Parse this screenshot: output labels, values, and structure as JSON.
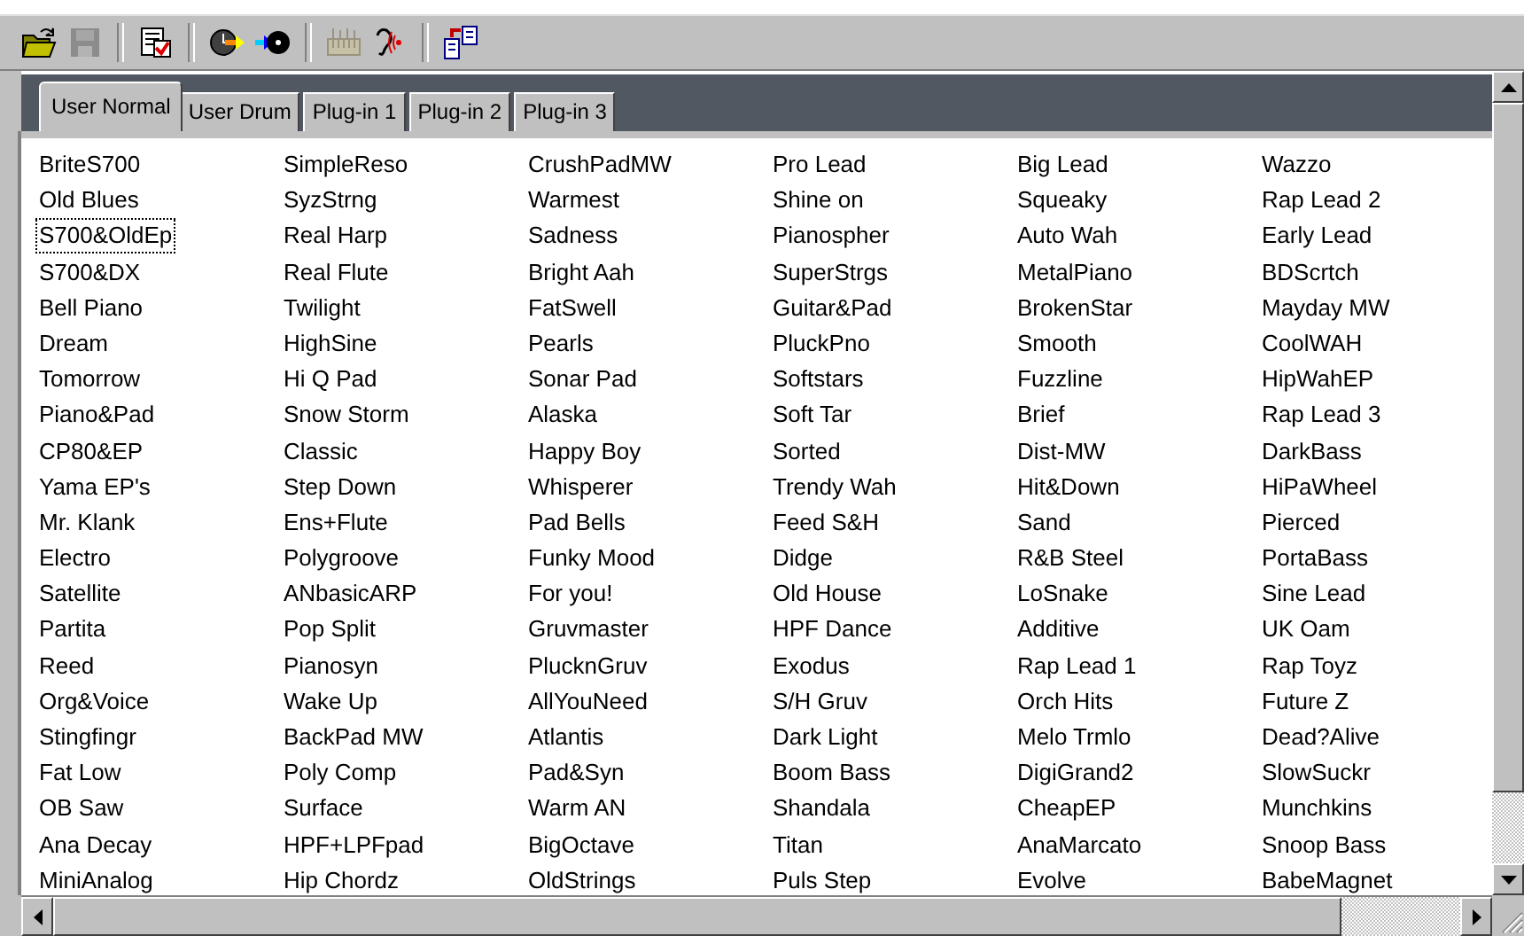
{
  "toolbar": [
    {
      "kind": "open",
      "disabled": false
    },
    {
      "kind": "save",
      "disabled": true
    },
    {
      "kind": "separator"
    },
    {
      "kind": "checklist",
      "disabled": false
    },
    {
      "kind": "separator"
    },
    {
      "kind": "clock-out",
      "disabled": false
    },
    {
      "kind": "disc-in",
      "disabled": false
    },
    {
      "kind": "separator"
    },
    {
      "kind": "keyboard",
      "disabled": true
    },
    {
      "kind": "ear",
      "disabled": false
    },
    {
      "kind": "separator"
    },
    {
      "kind": "export",
      "disabled": false
    }
  ],
  "tabs": [
    {
      "label": "User Normal",
      "selected": true
    },
    {
      "label": "User Drum",
      "selected": false
    },
    {
      "label": "Plug-in 1",
      "selected": false
    },
    {
      "label": "Plug-in 2",
      "selected": false
    },
    {
      "label": "Plug-in 3",
      "selected": false
    }
  ],
  "patches": [
    {
      "name": "BriteS700",
      "focused": false
    },
    {
      "name": "Old Blues",
      "focused": false
    },
    {
      "name": "S700&OldEp",
      "focused": true
    },
    {
      "name": "S700&DX",
      "focused": false
    },
    {
      "name": "Bell Piano",
      "focused": false
    },
    {
      "name": "Dream",
      "focused": false
    },
    {
      "name": "Tomorrow",
      "focused": false
    },
    {
      "name": "Piano&Pad",
      "focused": false
    },
    {
      "name": "CP80&EP",
      "focused": false
    },
    {
      "name": "Yama EP's",
      "focused": false
    },
    {
      "name": "Mr. Klank",
      "focused": false
    },
    {
      "name": "Electro",
      "focused": false
    },
    {
      "name": "Satellite",
      "focused": false
    },
    {
      "name": "Partita",
      "focused": false
    },
    {
      "name": "Reed",
      "focused": false
    },
    {
      "name": "Org&Voice",
      "focused": false
    },
    {
      "name": "Stingfingr",
      "focused": false
    },
    {
      "name": "Fat Low",
      "focused": false
    },
    {
      "name": "OB Saw",
      "focused": false
    },
    {
      "name": "Ana Decay",
      "focused": false
    },
    {
      "name": "MiniAnalog",
      "focused": false
    },
    {
      "name": "SimpleReso",
      "focused": false
    },
    {
      "name": "SyzStrng",
      "focused": false
    },
    {
      "name": "Real Harp",
      "focused": false
    },
    {
      "name": "Real Flute",
      "focused": false
    },
    {
      "name": "Twilight",
      "focused": false
    },
    {
      "name": "HighSine",
      "focused": false
    },
    {
      "name": "Hi Q Pad",
      "focused": false
    },
    {
      "name": "Snow Storm",
      "focused": false
    },
    {
      "name": "Classic",
      "focused": false
    },
    {
      "name": "Step Down",
      "focused": false
    },
    {
      "name": "Ens+Flute",
      "focused": false
    },
    {
      "name": "Polygroove",
      "focused": false
    },
    {
      "name": "ANbasicARP",
      "focused": false
    },
    {
      "name": "Pop Split",
      "focused": false
    },
    {
      "name": "Pianosyn",
      "focused": false
    },
    {
      "name": "Wake Up",
      "focused": false
    },
    {
      "name": "BackPad MW",
      "focused": false
    },
    {
      "name": "Poly Comp",
      "focused": false
    },
    {
      "name": "Surface",
      "focused": false
    },
    {
      "name": "HPF+LPFpad",
      "focused": false
    },
    {
      "name": "Hip Chordz",
      "focused": false
    },
    {
      "name": "CrushPadMW",
      "focused": false
    },
    {
      "name": "Warmest",
      "focused": false
    },
    {
      "name": "Sadness",
      "focused": false
    },
    {
      "name": "Bright Aah",
      "focused": false
    },
    {
      "name": "FatSwell",
      "focused": false
    },
    {
      "name": "Pearls",
      "focused": false
    },
    {
      "name": "Sonar Pad",
      "focused": false
    },
    {
      "name": "Alaska",
      "focused": false
    },
    {
      "name": "Happy Boy",
      "focused": false
    },
    {
      "name": "Whisperer",
      "focused": false
    },
    {
      "name": "Pad Bells",
      "focused": false
    },
    {
      "name": "Funky Mood",
      "focused": false
    },
    {
      "name": "For you!",
      "focused": false
    },
    {
      "name": "Gruvmaster",
      "focused": false
    },
    {
      "name": "PlucknGruv",
      "focused": false
    },
    {
      "name": "AllYouNeed",
      "focused": false
    },
    {
      "name": "Atlantis",
      "focused": false
    },
    {
      "name": "Pad&Syn",
      "focused": false
    },
    {
      "name": "Warm AN",
      "focused": false
    },
    {
      "name": "BigOctave",
      "focused": false
    },
    {
      "name": "OldStrings",
      "focused": false
    },
    {
      "name": "Pro Lead",
      "focused": false
    },
    {
      "name": "Shine on",
      "focused": false
    },
    {
      "name": "Pianospher",
      "focused": false
    },
    {
      "name": "SuperStrgs",
      "focused": false
    },
    {
      "name": "Guitar&Pad",
      "focused": false
    },
    {
      "name": "PluckPno",
      "focused": false
    },
    {
      "name": "Softstars",
      "focused": false
    },
    {
      "name": "Soft Tar",
      "focused": false
    },
    {
      "name": "Sorted",
      "focused": false
    },
    {
      "name": "Trendy Wah",
      "focused": false
    },
    {
      "name": "Feed S&H",
      "focused": false
    },
    {
      "name": "Didge",
      "focused": false
    },
    {
      "name": "Old House",
      "focused": false
    },
    {
      "name": "HPF Dance",
      "focused": false
    },
    {
      "name": "Exodus",
      "focused": false
    },
    {
      "name": "S/H Gruv",
      "focused": false
    },
    {
      "name": "Dark Light",
      "focused": false
    },
    {
      "name": "Boom Bass",
      "focused": false
    },
    {
      "name": "Shandala",
      "focused": false
    },
    {
      "name": "Titan",
      "focused": false
    },
    {
      "name": "Puls Step",
      "focused": false
    },
    {
      "name": "Big Lead",
      "focused": false
    },
    {
      "name": "Squeaky",
      "focused": false
    },
    {
      "name": "Auto Wah",
      "focused": false
    },
    {
      "name": "MetalPiano",
      "focused": false
    },
    {
      "name": "BrokenStar",
      "focused": false
    },
    {
      "name": "Smooth",
      "focused": false
    },
    {
      "name": "Fuzzline",
      "focused": false
    },
    {
      "name": "Brief",
      "focused": false
    },
    {
      "name": "Dist-MW",
      "focused": false
    },
    {
      "name": "Hit&Down",
      "focused": false
    },
    {
      "name": "Sand",
      "focused": false
    },
    {
      "name": "R&B Steel",
      "focused": false
    },
    {
      "name": "LoSnake",
      "focused": false
    },
    {
      "name": "Additive",
      "focused": false
    },
    {
      "name": "Rap Lead 1",
      "focused": false
    },
    {
      "name": "Orch Hits",
      "focused": false
    },
    {
      "name": "Melo Trmlo",
      "focused": false
    },
    {
      "name": "DigiGrand2",
      "focused": false
    },
    {
      "name": "CheapEP",
      "focused": false
    },
    {
      "name": "AnaMarcato",
      "focused": false
    },
    {
      "name": "Evolve",
      "focused": false
    },
    {
      "name": "Wazzo",
      "focused": false
    },
    {
      "name": "Rap Lead 2",
      "focused": false
    },
    {
      "name": "Early Lead",
      "focused": false
    },
    {
      "name": "BDScrtch",
      "focused": false
    },
    {
      "name": "Mayday MW",
      "focused": false
    },
    {
      "name": "CoolWAH",
      "focused": false
    },
    {
      "name": "HipWahEP",
      "focused": false
    },
    {
      "name": "Rap Lead 3",
      "focused": false
    },
    {
      "name": "DarkBass",
      "focused": false
    },
    {
      "name": "HiPaWheel",
      "focused": false
    },
    {
      "name": "Pierced",
      "focused": false
    },
    {
      "name": "PortaBass",
      "focused": false
    },
    {
      "name": "Sine Lead",
      "focused": false
    },
    {
      "name": "UK Oam",
      "focused": false
    },
    {
      "name": "Rap Toyz",
      "focused": false
    },
    {
      "name": "Future Z",
      "focused": false
    },
    {
      "name": "Dead?Alive",
      "focused": false
    },
    {
      "name": "SlowSuckr",
      "focused": false
    },
    {
      "name": "Munchkins",
      "focused": false
    },
    {
      "name": "Snoop Bass",
      "focused": false
    },
    {
      "name": "BabeMagnet",
      "focused": false
    }
  ]
}
